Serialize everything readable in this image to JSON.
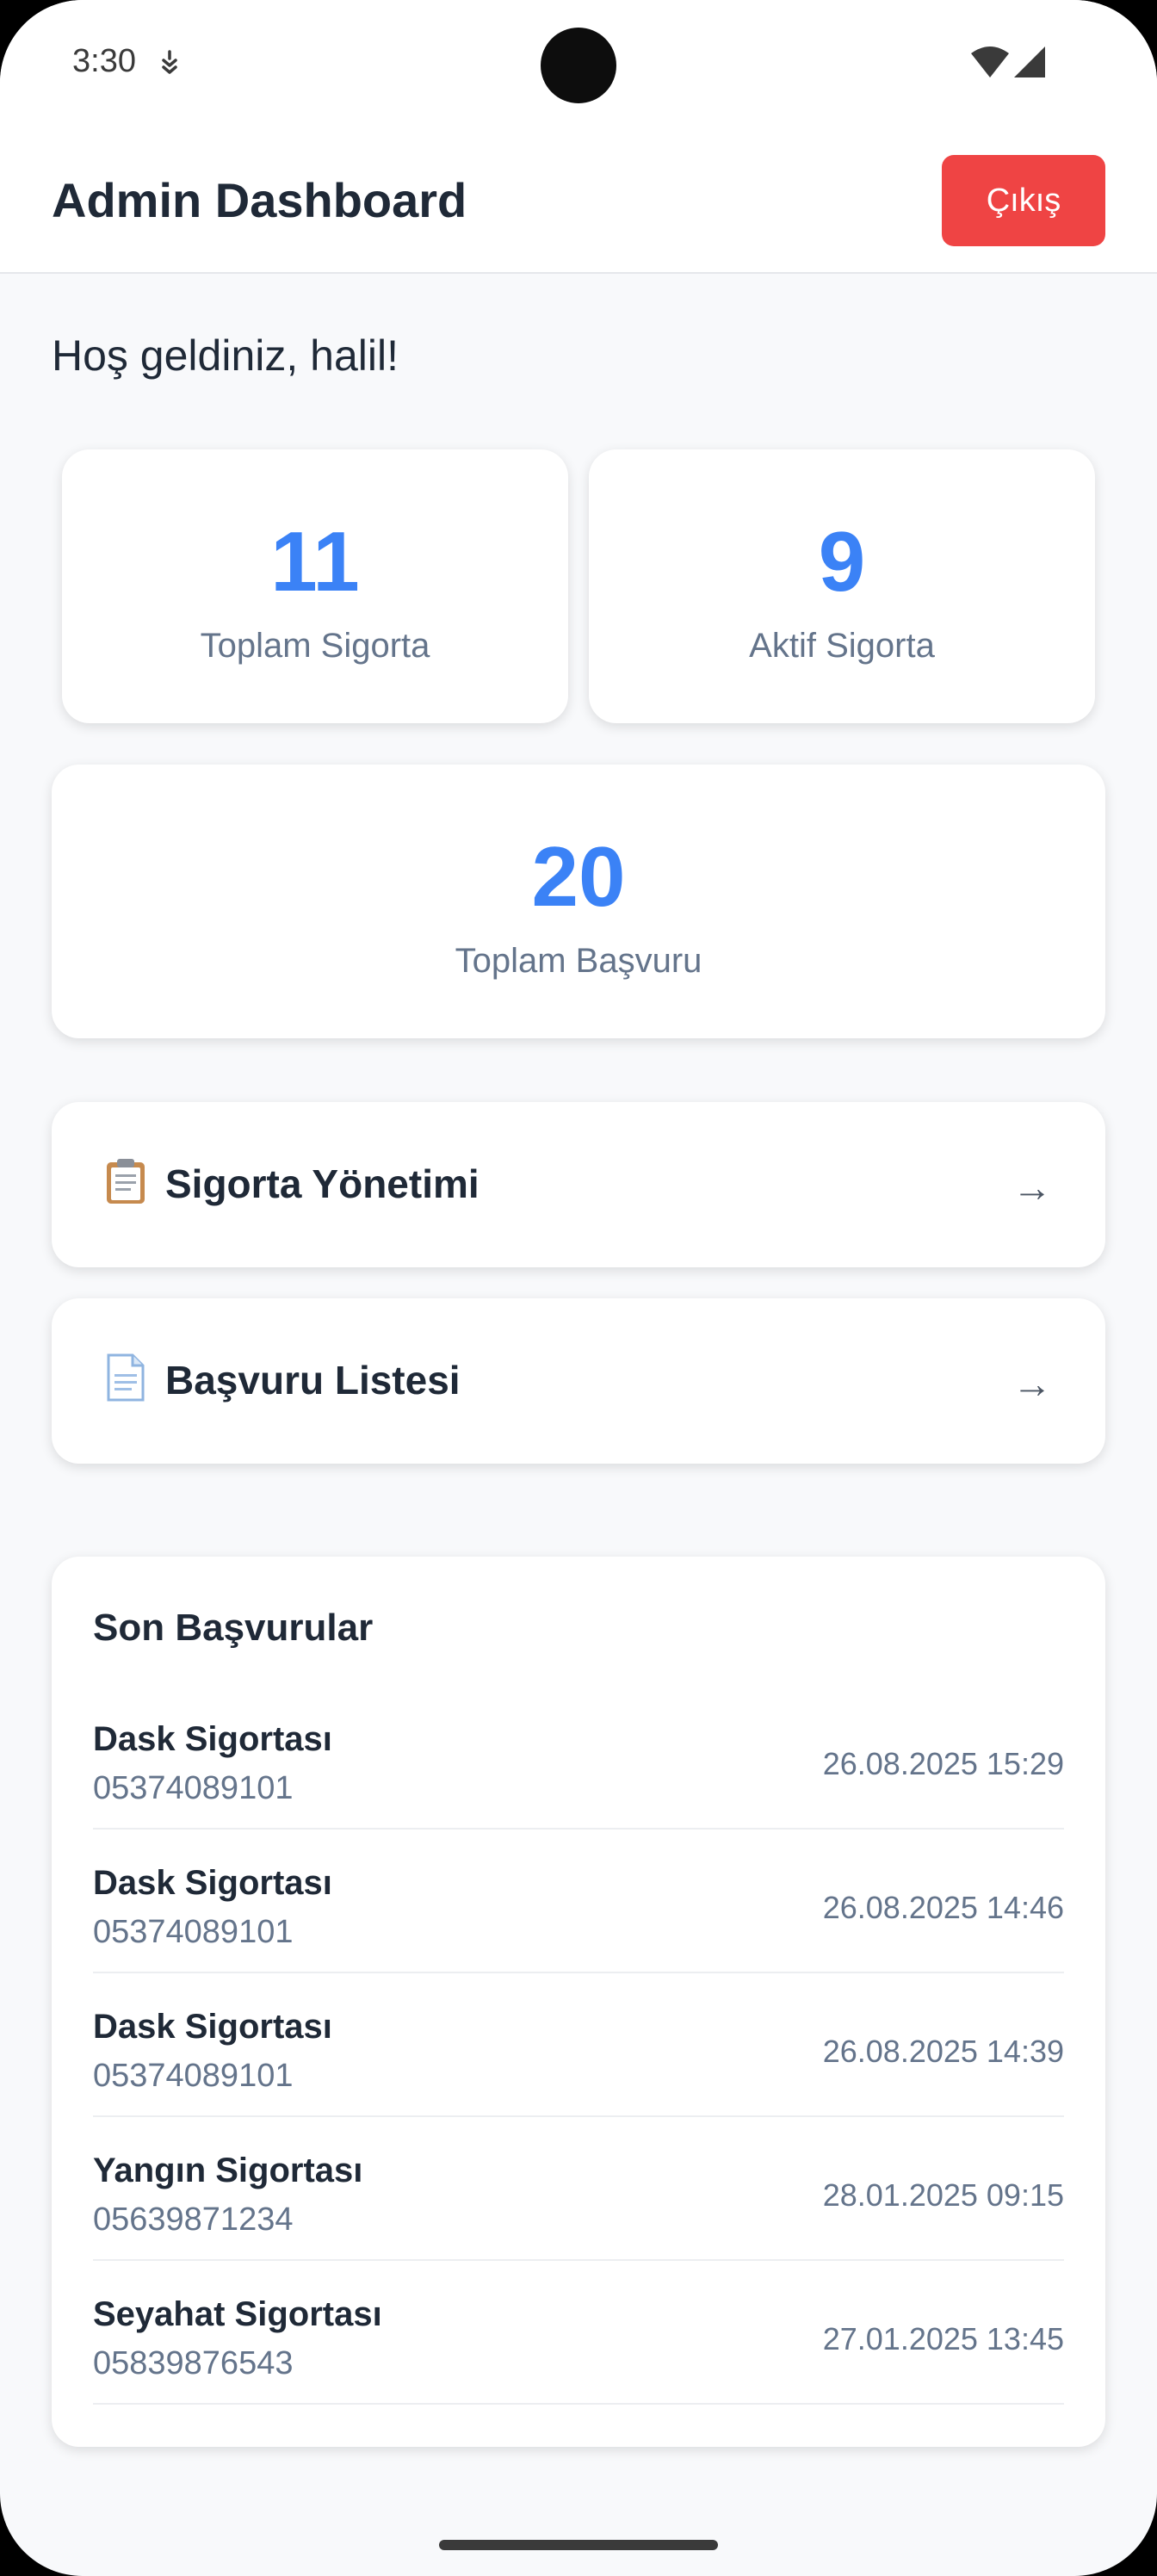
{
  "status_bar": {
    "time": "3:30",
    "icons": [
      "notification-icon",
      "wifi-icon",
      "signal-icon"
    ]
  },
  "header": {
    "title": "Admin Dashboard",
    "logout_label": "Çıkış"
  },
  "welcome": "Hoş geldiniz, halil!",
  "stats": {
    "total_insurance": {
      "value": "11",
      "label": "Toplam Sigorta"
    },
    "active_insurance": {
      "value": "9",
      "label": "Aktif Sigorta"
    },
    "total_applications": {
      "value": "20",
      "label": "Toplam Başvuru"
    }
  },
  "nav": [
    {
      "icon": "clipboard-icon",
      "label": "Sigorta Yönetimi",
      "arrow": "→"
    },
    {
      "icon": "document-icon",
      "label": "Başvuru Listesi",
      "arrow": "→"
    }
  ],
  "recent": {
    "title": "Son Başvurular",
    "items": [
      {
        "name": "Dask Sigortası",
        "phone": "05374089101",
        "date": "26.08.2025 15:29"
      },
      {
        "name": "Dask Sigortası",
        "phone": "05374089101",
        "date": "26.08.2025 14:46"
      },
      {
        "name": "Dask Sigortası",
        "phone": "05374089101",
        "date": "26.08.2025 14:39"
      },
      {
        "name": "Yangın Sigortası",
        "phone": "05639871234",
        "date": "28.01.2025 09:15"
      },
      {
        "name": "Seyahat Sigortası",
        "phone": "05839876543",
        "date": "27.01.2025 13:45"
      }
    ]
  },
  "colors": {
    "accent": "#3b82f6",
    "danger": "#ef4444",
    "text_primary": "#1f2937",
    "text_secondary": "#64748b",
    "background": "#f8f9fb"
  }
}
